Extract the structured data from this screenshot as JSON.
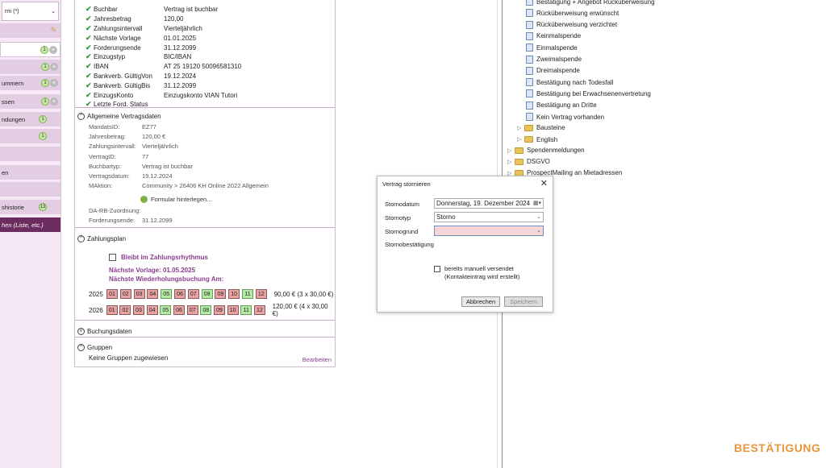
{
  "sidebar": {
    "top_text": "rm (*)",
    "items": [
      {
        "label": "",
        "badge": "",
        "type": "pencil"
      },
      {
        "label": "",
        "badge": "1",
        "type": "white"
      },
      {
        "label": "",
        "badge": "1",
        "type": "normal"
      },
      {
        "label": "ummern",
        "badge": "1",
        "type": "normal"
      },
      {
        "label": "ssen",
        "badge": "1",
        "type": "normal"
      },
      {
        "label": "ndungen",
        "badge": "1",
        "type": "normal-solo"
      },
      {
        "label": "",
        "badge": "1",
        "type": "normal-solo"
      },
      {
        "label": "",
        "badge": "",
        "type": "normal"
      },
      {
        "label": "en",
        "badge": "",
        "type": "normal"
      },
      {
        "label": "",
        "badge": "",
        "type": "normal"
      },
      {
        "label": "shistorie",
        "badge": "13",
        "type": "normal-solo"
      },
      {
        "label": "hen (Liste, etc.)",
        "badge": "",
        "type": "dark"
      }
    ]
  },
  "checks": [
    {
      "label": "Buchbar",
      "value": "Vertrag ist buchbar"
    },
    {
      "label": "Jahresbetrag",
      "value": "120,00"
    },
    {
      "label": "Zahlungsintervall",
      "value": "Vierteljährlich"
    },
    {
      "label": "Nächste Vorlage",
      "value": "01.01.2025"
    },
    {
      "label": "Forderungsende",
      "value": "31.12.2099"
    },
    {
      "label": "Einzugstyp",
      "value": "BIC/IBAN"
    },
    {
      "label": "IBAN",
      "value": "AT 25 19120 50096581310"
    },
    {
      "label": "Bankverb. GültigVon",
      "value": "19.12.2024"
    },
    {
      "label": "Bankverb. GültigBis",
      "value": "31.12.2099"
    },
    {
      "label": "EinzugsKonto",
      "value": "Einzugskonto VIAN Tutori"
    },
    {
      "label": "Letzte Ford. Status",
      "value": ""
    }
  ],
  "vertrag": {
    "header": "Allgemeine Vertragsdaten",
    "rows": [
      {
        "k": "MandatsID:",
        "v": "EZ77"
      },
      {
        "k": "Jahresbetrag:",
        "v": "120,00 €"
      },
      {
        "k": "Zahlungsintervall:",
        "v": "Vierteljährlich"
      },
      {
        "k": "VertragID:",
        "v": "77"
      },
      {
        "k": "Buchbartyp:",
        "v": "Vertrag ist buchbar"
      },
      {
        "k": "Vertragsdatum:",
        "v": "19.12.2024"
      },
      {
        "k": "MAktion:",
        "v": "Community  >  26406 KH Online 2022 Allgemein"
      }
    ],
    "formular_link": "Formular hinterlegen...",
    "da_rb": "DA-RB-Zuordnung:",
    "forderungsende_k": "Forderungsende:",
    "forderungsende_v": "31.12.2099"
  },
  "zahlungsplan": {
    "header": "Zahlungsplan",
    "bleibt": "Bleibt im Zahlungsrhythmus",
    "naechste_vorlage": "Nächste Vorlage: 01.05.2025",
    "naechste_wiederholung": "Nächste Wiederholungsbuchung Am:",
    "years": [
      {
        "year": "2025",
        "months": [
          "r",
          "r",
          "r",
          "r",
          "g",
          "r",
          "r",
          "g",
          "r",
          "r",
          "g",
          "r"
        ],
        "total": "90,00 € (3 x 30,00 €)"
      },
      {
        "year": "2026",
        "months": [
          "r",
          "r",
          "r",
          "r",
          "g",
          "r",
          "r",
          "g",
          "r",
          "r",
          "g",
          "r"
        ],
        "total": "120,00 € (4 x 30,00 €)"
      }
    ],
    "month_labels": [
      "01",
      "02",
      "03",
      "04",
      "05",
      "06",
      "07",
      "08",
      "09",
      "10",
      "11",
      "12"
    ]
  },
  "buchungsdaten": {
    "header": "Buchungsdaten"
  },
  "gruppen": {
    "header": "Gruppen",
    "empty": "Keine Gruppen zugewiesen",
    "edit": "Bearbeiten"
  },
  "tree": {
    "docs": [
      "Bestätigung + Angebot Rücküberweisung",
      "Rücküberweisung erwünscht",
      "Rücküberweisung verzichtet",
      "Keinmalspende",
      "Einmalspende",
      "Zweimalspende",
      "Dreimalspende",
      "Bestätigung nach Todesfall",
      "Bestätigung bei Erwachsenenvertretung",
      "Bestätigung an Dritte",
      "Kein Vertrag vorhanden"
    ],
    "subfolders": [
      "Bausteine",
      "English"
    ],
    "folders": [
      "Spendenmeldungen",
      "DSGVO",
      "ProspectMailing an Mietadressen"
    ]
  },
  "dialog": {
    "title": "Vertrag stornieren",
    "close": "✕",
    "stornodatum_label": "Stornodatum",
    "stornodatum_value": "Donnerstag, 19.  Dezember 2024",
    "stornotyp_label": "Stornotyp",
    "stornotyp_value": "Storno",
    "stornogrund_label": "Stornogrund",
    "stornogrund_value": "",
    "stornobestaetigung_label": "Stornobestätigung",
    "manuell_label": "bereits manuell versendet",
    "manuell_sub": "(Kontakteintrag wird erstellt)",
    "cancel_label": "Abbrechen",
    "save_label": "Speichern"
  },
  "watermark": "BESTÄTIGUNG",
  "colors": {
    "accent": "#8b3e8f",
    "sidebar": "#e3cde3",
    "watermark": "#e8963a"
  }
}
